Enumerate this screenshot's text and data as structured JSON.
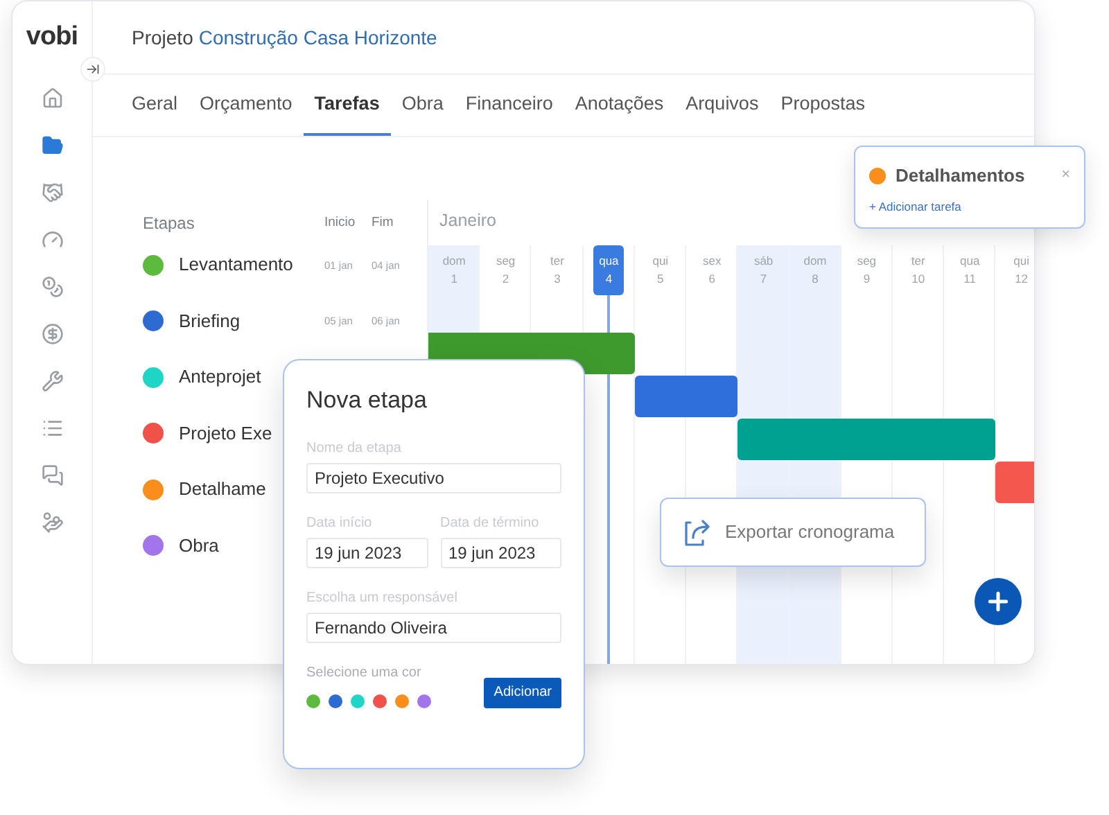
{
  "logo": "vobi",
  "sidebar": {
    "items": [
      {
        "kind": "home",
        "selected": false
      },
      {
        "kind": "folder",
        "selected": true
      },
      {
        "kind": "handshake",
        "selected": false
      },
      {
        "kind": "gauge",
        "selected": false
      },
      {
        "kind": "coins",
        "selected": false
      },
      {
        "kind": "dollar",
        "selected": false
      },
      {
        "kind": "tools",
        "selected": false
      },
      {
        "kind": "list",
        "selected": false
      },
      {
        "kind": "chat",
        "selected": false
      },
      {
        "kind": "hand-dollar",
        "selected": false
      }
    ]
  },
  "header": {
    "prefix": "Projeto",
    "project": "Construção Casa Horizonte"
  },
  "tabs": [
    {
      "label": "Geral",
      "selected": false
    },
    {
      "label": "Orçamento",
      "selected": false
    },
    {
      "label": "Tarefas",
      "selected": true
    },
    {
      "label": "Obra",
      "selected": false
    },
    {
      "label": "Financeiro",
      "selected": false
    },
    {
      "label": "Anotações",
      "selected": false
    },
    {
      "label": "Arquivos",
      "selected": false
    },
    {
      "label": "Propostas",
      "selected": false
    }
  ],
  "stages": {
    "columns": [
      "Etapas",
      "Inicio",
      "Fim"
    ],
    "rows": [
      {
        "name": "Levantamento",
        "color": "#5cbb3e",
        "start": "01 jan",
        "end": "04 jan"
      },
      {
        "name": "Briefing",
        "color": "#2d6bd3",
        "start": "05 jan",
        "end": "06 jan"
      },
      {
        "name": "Anteprojet",
        "color": "#1fd6c6"
      },
      {
        "name": "Projeto Exe",
        "color": "#f0524a"
      },
      {
        "name": "Detalhame",
        "color": "#f98e1d"
      },
      {
        "name": "Obra",
        "color": "#a275ea"
      }
    ]
  },
  "timeline": {
    "month": "Janeiro",
    "days": [
      {
        "name": "dom",
        "num": "1",
        "weekend": true,
        "selected": false,
        "color": "#3f9a2e"
      },
      {
        "name": "seg",
        "num": "2",
        "weekend": false,
        "selected": false,
        "color": "#3f9a2e"
      },
      {
        "name": "ter",
        "num": "3",
        "weekend": false,
        "selected": false,
        "color": "#3f9a2e"
      },
      {
        "name": "qua",
        "num": "4",
        "weekend": false,
        "selected": true,
        "color": "#3f9a2e"
      },
      {
        "name": "qui",
        "num": "5",
        "weekend": false,
        "selected": false,
        "color": "#2f6fdb"
      },
      {
        "name": "sex",
        "num": "6",
        "weekend": false,
        "selected": false,
        "color": "#2f6fdb"
      },
      {
        "name": "sáb",
        "num": "7",
        "weekend": true,
        "selected": false,
        "color": "#00a191"
      },
      {
        "name": "dom",
        "num": "8",
        "weekend": true,
        "selected": false,
        "color": "#00a191"
      },
      {
        "name": "seg",
        "num": "9",
        "weekend": false,
        "selected": false,
        "color": "#00a191"
      },
      {
        "name": "ter",
        "num": "10",
        "weekend": false,
        "selected": false,
        "color": "#00a191"
      },
      {
        "name": "qua",
        "num": "11",
        "weekend": false,
        "selected": false,
        "color": "#00a191"
      },
      {
        "name": "qui",
        "num": "12",
        "weekend": false,
        "selected": false,
        "color": "#f4574d"
      }
    ]
  },
  "detail_popover": {
    "title": "Detalhamentos",
    "color": "#f98e1d",
    "close": "×",
    "link": "+ Adicionar tarefa"
  },
  "new_stage": {
    "title": "Nova etapa",
    "name_label": "Nome da etapa",
    "name_value": "Projeto Executivo",
    "start_label": "Data início",
    "start_value": "19 jun 2023",
    "end_label": "Data de término",
    "end_value": "19 jun 2023",
    "owner_label": "Escolha um responsável",
    "owner_value": "Fernando Oliveira",
    "color_label": "Selecione uma cor",
    "colors": [
      {
        "color": "#5cbb3e"
      },
      {
        "color": "#2d6bd3"
      },
      {
        "color": "#1fd6c6"
      },
      {
        "color": "#f0524a"
      },
      {
        "color": "#f98e1d"
      },
      {
        "color": "#a275ea"
      }
    ],
    "submit": "Adicionar"
  },
  "export_button": "Exportar cronograma"
}
